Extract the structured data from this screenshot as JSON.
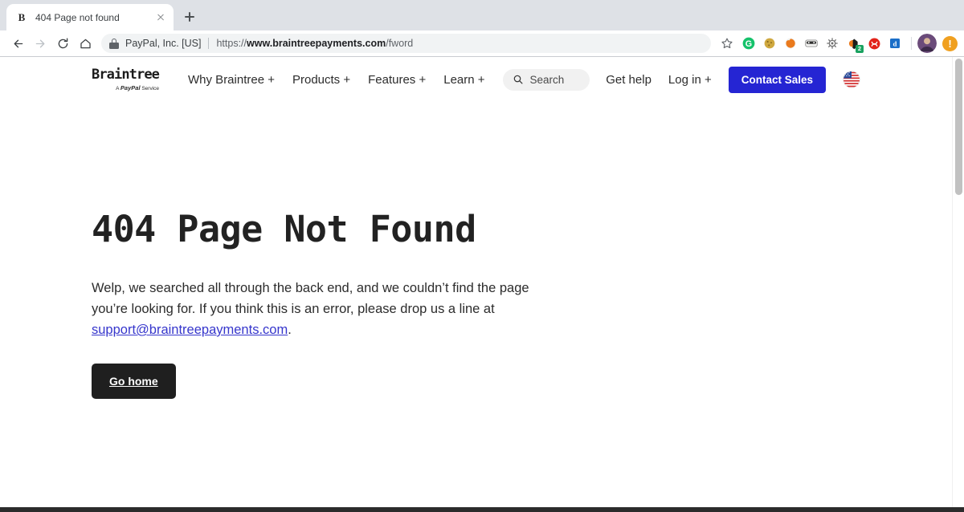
{
  "browser": {
    "tab": {
      "favicon_letter": "B",
      "favicon_icon": "braintree-b-favicon",
      "title": "404 Page not found",
      "close_icon": "close-icon"
    },
    "new_tab_icon": "plus-icon",
    "nav": {
      "back_icon": "back-arrow-icon",
      "forward_icon": "forward-arrow-icon",
      "reload_icon": "reload-icon",
      "home_icon": "home-icon"
    },
    "omnibox": {
      "lock_icon": "lock-icon",
      "site_identity": "PayPal, Inc. [US]",
      "url_prefix": "https://",
      "url_domain": "www.braintreepayments.com",
      "url_path": "/fword",
      "bookmark_icon": "star-icon"
    },
    "extensions": [
      {
        "name": "grammarly-extension-icon",
        "glyph": "G",
        "color": "#15c26b"
      },
      {
        "name": "cookie-extension-icon",
        "glyph": "",
        "color": "#c9a227"
      },
      {
        "name": "orange-swirl-extension-icon",
        "glyph": "",
        "color": "#e8821a"
      },
      {
        "name": "bitwarden-extension-icon",
        "glyph": "",
        "color": "#3b3b3b"
      },
      {
        "name": "gear-extension-icon",
        "glyph": "",
        "color": "#6e6e6e"
      },
      {
        "name": "honey-extension-icon",
        "glyph": "",
        "color": "#e8721a",
        "badge": "2"
      },
      {
        "name": "adobe-extension-icon",
        "glyph": "",
        "color": "#e2231a"
      },
      {
        "name": "dashlane-extension-icon",
        "glyph": "d",
        "color": "#1a6ec8"
      }
    ],
    "profile": {
      "name": "profile-avatar",
      "alert_glyph": "!"
    }
  },
  "site": {
    "logo": {
      "word": "Braintree",
      "tagline_prefix": "A ",
      "tagline_brand": "PayPal",
      "tagline_suffix": " Service"
    },
    "nav": [
      {
        "label": "Why Braintree +",
        "name": "nav-why-braintree"
      },
      {
        "label": "Products +",
        "name": "nav-products"
      },
      {
        "label": "Features +",
        "name": "nav-features"
      },
      {
        "label": "Learn +",
        "name": "nav-learn"
      }
    ],
    "search": {
      "placeholder": "Search",
      "icon": "search-icon"
    },
    "right_nav": [
      {
        "label": "Get help",
        "name": "nav-get-help"
      },
      {
        "label": "Log in +",
        "name": "nav-log-in"
      }
    ],
    "contact_button": {
      "label": "Contact Sales",
      "color": "#2525d3"
    },
    "locale_flag": "us-flag-icon"
  },
  "main": {
    "title": "404 Page Not Found",
    "body_part1": "Welp, we searched all through the back end, and we couldn’t find the page you’re looking for. If you think this is an error, please drop us a line at ",
    "body_link": "support@braintreepayments.com",
    "body_part2": ".",
    "link_color": "#3636cc",
    "go_home_button": {
      "label": "Go home",
      "color": "#1f1f1f"
    }
  }
}
